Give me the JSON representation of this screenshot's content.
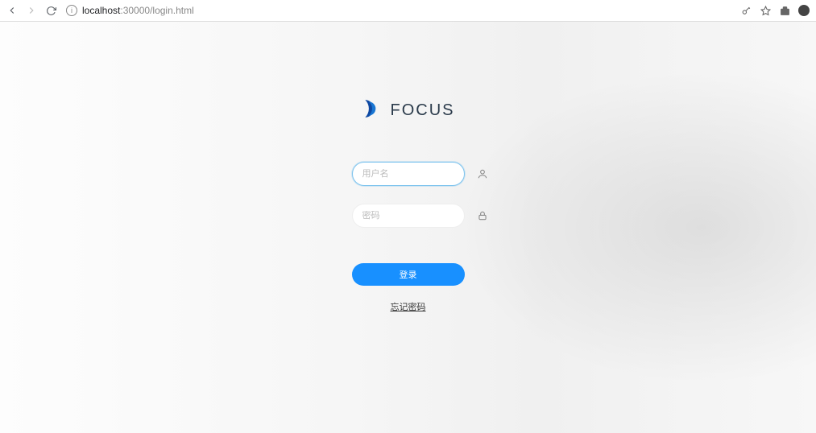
{
  "browser": {
    "url_host": "localhost",
    "url_rest": ":30000/login.html"
  },
  "logo": {
    "text": "FOCUS"
  },
  "form": {
    "username_placeholder": "用户名",
    "password_placeholder": "密码",
    "login_button": "登录",
    "forgot_link": "忘记密码"
  }
}
